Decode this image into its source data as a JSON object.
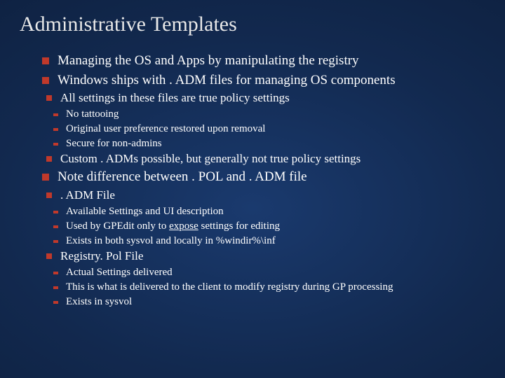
{
  "title": "Administrative Templates",
  "b1": "Managing the OS and Apps by manipulating the registry",
  "b2": "Windows ships with . ADM files for managing OS components",
  "b2_1": "All settings in these files are true policy settings",
  "b2_1_1": "No tattooing",
  "b2_1_2": "Original user preference restored upon removal",
  "b2_1_3": "Secure for non-admins",
  "b2_2": "Custom . ADMs possible, but generally not true policy settings",
  "b3": "Note difference between . POL and . ADM file",
  "b3_1": ". ADM File",
  "b3_1_1": "Available Settings and UI description",
  "b3_1_2a": "Used by GPEdit only to ",
  "b3_1_2b": "expose",
  "b3_1_2c": " settings for editing",
  "b3_1_3": "Exists in both sysvol and locally in %windir%\\inf",
  "b3_2": "Registry. Pol File",
  "b3_2_1": "Actual Settings delivered",
  "b3_2_2": "This is what is delivered to the client to modify registry during GP processing",
  "b3_2_3": "Exists in sysvol"
}
